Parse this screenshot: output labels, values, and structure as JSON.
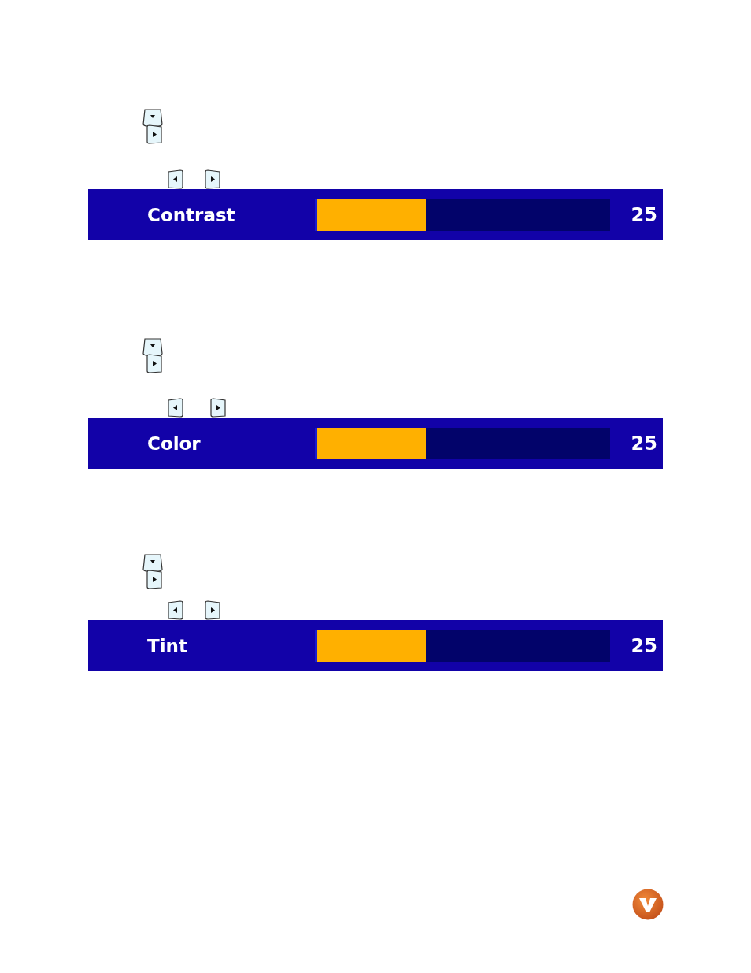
{
  "settings": [
    {
      "name": "Contrast",
      "level": 0.37,
      "reading": "25"
    },
    {
      "name": "Color",
      "level": 0.37,
      "reading": "25"
    },
    {
      "name": "Tint",
      "level": 0.37,
      "reading": "25"
    }
  ]
}
